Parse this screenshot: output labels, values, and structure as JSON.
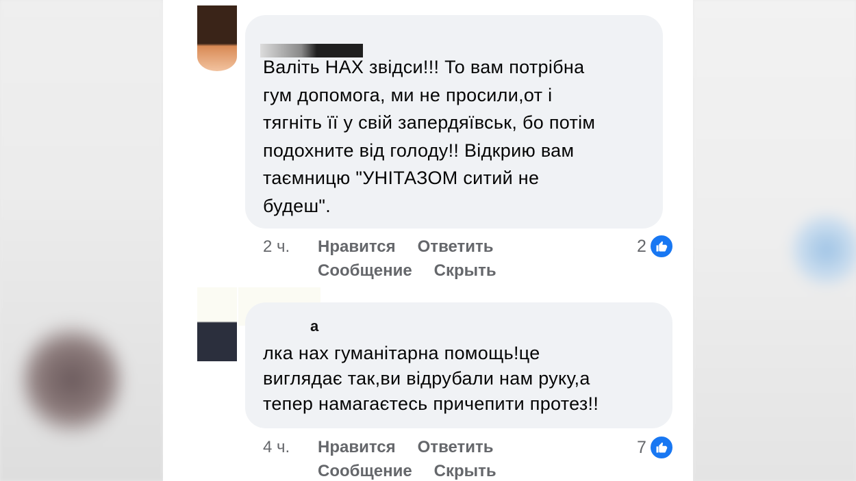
{
  "comments": [
    {
      "text": "Валіть НАХ звідси!!! То вам потрібна\nгум допомога, ми не просили,от і\nтягніть її у свій запердяївськ, бо потім\nподохните від голоду!! Відкрию вам\nтаємницю   \"УНІТАЗОМ ситий не\nбудеш\".",
      "time": "2 ч.",
      "like_label": "Нравится",
      "reply_label": "Ответить",
      "message_label": "Сообщение",
      "hide_label": "Скрыть",
      "reaction_count": "2"
    },
    {
      "author_fragment": "а",
      "text": "лка нах гуманітарна помощь!це\nвиглядає так,ви відрубали нам руку,а\nтепер намагаєтесь причепити протез!!",
      "time": "4 ч.",
      "like_label": "Нравится",
      "reply_label": "Ответить",
      "message_label": "Сообщение",
      "hide_label": "Скрыть",
      "reaction_count": "7"
    }
  ],
  "icons": {
    "reaction": "like-icon"
  },
  "colors": {
    "bubble": "#f0f2f5",
    "meta": "#65676b",
    "like": "#1877f2"
  }
}
